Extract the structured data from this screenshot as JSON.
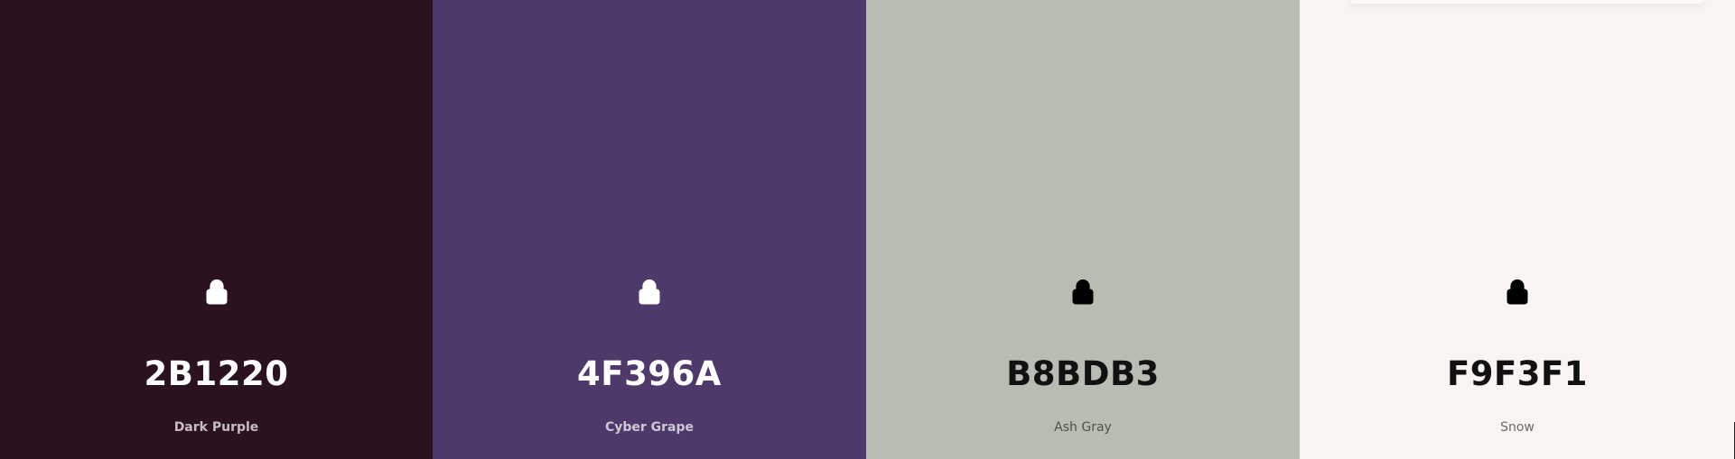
{
  "swatches": [
    {
      "hex": "2B1220",
      "name": "Dark Purple",
      "color": "#2B1220",
      "text_theme": "light",
      "icon": "lock-icon"
    },
    {
      "hex": "4F396A",
      "name": "Cyber Grape",
      "color": "#4F396A",
      "text_theme": "light",
      "icon": "lock-icon"
    },
    {
      "hex": "B8BDB3",
      "name": "Ash Gray",
      "color": "#B8BDB3",
      "text_theme": "dark",
      "icon": "lock-icon"
    },
    {
      "hex": "F9F3F1",
      "name": "Snow",
      "color": "#F9F3F1",
      "text_theme": "dark",
      "icon": "lock-icon"
    }
  ]
}
